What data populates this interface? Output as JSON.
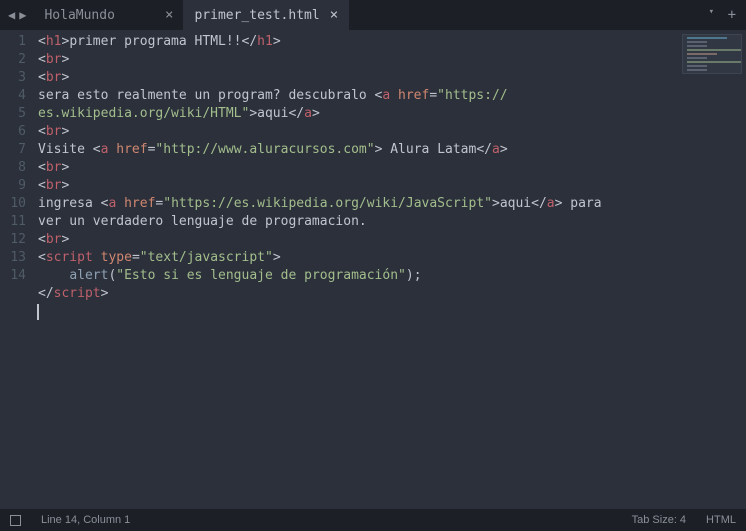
{
  "tabs": [
    {
      "label": "HolaMundo",
      "active": false
    },
    {
      "label": "primer_test.html",
      "active": true
    }
  ],
  "gutter": [
    "1",
    "2",
    "3",
    "4",
    "5",
    "6",
    "7",
    "8",
    "9",
    "10",
    "11",
    "12",
    "13",
    "14"
  ],
  "code": {
    "l1": [
      [
        "<",
        "t-punc"
      ],
      [
        "h1",
        "t-tag"
      ],
      [
        ">",
        "t-punc"
      ],
      [
        "primer programa HTML!!",
        "t-text"
      ],
      [
        "</",
        "t-punc"
      ],
      [
        "h1",
        "t-tag"
      ],
      [
        ">",
        "t-punc"
      ]
    ],
    "l2": [
      [
        "<",
        "t-punc"
      ],
      [
        "br",
        "t-tag"
      ],
      [
        ">",
        "t-punc"
      ]
    ],
    "l3": [
      [
        "<",
        "t-punc"
      ],
      [
        "br",
        "t-tag"
      ],
      [
        ">",
        "t-punc"
      ]
    ],
    "l4a": [
      [
        "sera esto realmente un program? descubralo ",
        "t-text"
      ],
      [
        "<",
        "t-punc"
      ],
      [
        "a",
        "t-tag"
      ],
      [
        " ",
        "t-punc"
      ],
      [
        "href",
        "t-attr"
      ],
      [
        "=",
        "t-punc"
      ],
      [
        "\"https://",
        "t-str"
      ]
    ],
    "l4b": [
      [
        "es.wikipedia.org/wiki/HTML\"",
        "t-str"
      ],
      [
        ">",
        "t-punc"
      ],
      [
        "aqui",
        "t-text"
      ],
      [
        "</",
        "t-punc"
      ],
      [
        "a",
        "t-tag"
      ],
      [
        ">",
        "t-punc"
      ]
    ],
    "l5": [
      [
        "<",
        "t-punc"
      ],
      [
        "br",
        "t-tag"
      ],
      [
        ">",
        "t-punc"
      ]
    ],
    "l6": [
      [
        "Visite ",
        "t-text"
      ],
      [
        "<",
        "t-punc"
      ],
      [
        "a",
        "t-tag"
      ],
      [
        " ",
        "t-punc"
      ],
      [
        "href",
        "t-attr"
      ],
      [
        "=",
        "t-punc"
      ],
      [
        "\"http://www.aluracursos.com\"",
        "t-str"
      ],
      [
        ">",
        "t-punc"
      ],
      [
        " Alura Latam",
        "t-text"
      ],
      [
        "</",
        "t-punc"
      ],
      [
        "a",
        "t-tag"
      ],
      [
        ">",
        "t-punc"
      ]
    ],
    "l7": [
      [
        "<",
        "t-punc"
      ],
      [
        "br",
        "t-tag"
      ],
      [
        ">",
        "t-punc"
      ]
    ],
    "l8": [
      [
        "<",
        "t-punc"
      ],
      [
        "br",
        "t-tag"
      ],
      [
        ">",
        "t-punc"
      ]
    ],
    "l9a": [
      [
        "ingresa ",
        "t-text"
      ],
      [
        "<",
        "t-punc"
      ],
      [
        "a",
        "t-tag"
      ],
      [
        " ",
        "t-punc"
      ],
      [
        "href",
        "t-attr"
      ],
      [
        "=",
        "t-punc"
      ],
      [
        "\"https://es.wikipedia.org/wiki/JavaScript\"",
        "t-str"
      ],
      [
        ">",
        "t-punc"
      ],
      [
        "aqui",
        "t-text"
      ],
      [
        "</",
        "t-punc"
      ],
      [
        "a",
        "t-tag"
      ],
      [
        ">",
        "t-punc"
      ],
      [
        " para",
        "t-text"
      ]
    ],
    "l9b": [
      [
        "ver un verdadero lenguaje de programacion.",
        "t-text"
      ]
    ],
    "l10": [
      [
        "<",
        "t-punc"
      ],
      [
        "br",
        "t-tag"
      ],
      [
        ">",
        "t-punc"
      ]
    ],
    "l11": [
      [
        "<",
        "t-punc"
      ],
      [
        "script",
        "t-tag"
      ],
      [
        " ",
        "t-punc"
      ],
      [
        "type",
        "t-attr"
      ],
      [
        "=",
        "t-punc"
      ],
      [
        "\"text/javascript\"",
        "t-str"
      ],
      [
        ">",
        "t-punc"
      ]
    ],
    "l12": [
      [
        "    ",
        "t-text"
      ],
      [
        "alert",
        "t-fn"
      ],
      [
        "(",
        "t-punc"
      ],
      [
        "\"Esto si es lenguaje de programación\"",
        "t-str"
      ],
      [
        ");",
        "t-punc"
      ]
    ],
    "l13": [
      [
        "</",
        "t-punc"
      ],
      [
        "script",
        "t-tag"
      ],
      [
        ">",
        "t-punc"
      ]
    ]
  },
  "status": {
    "cursor": "Line 14, Column 1",
    "tabsize": "Tab Size: 4",
    "lang": "HTML"
  }
}
